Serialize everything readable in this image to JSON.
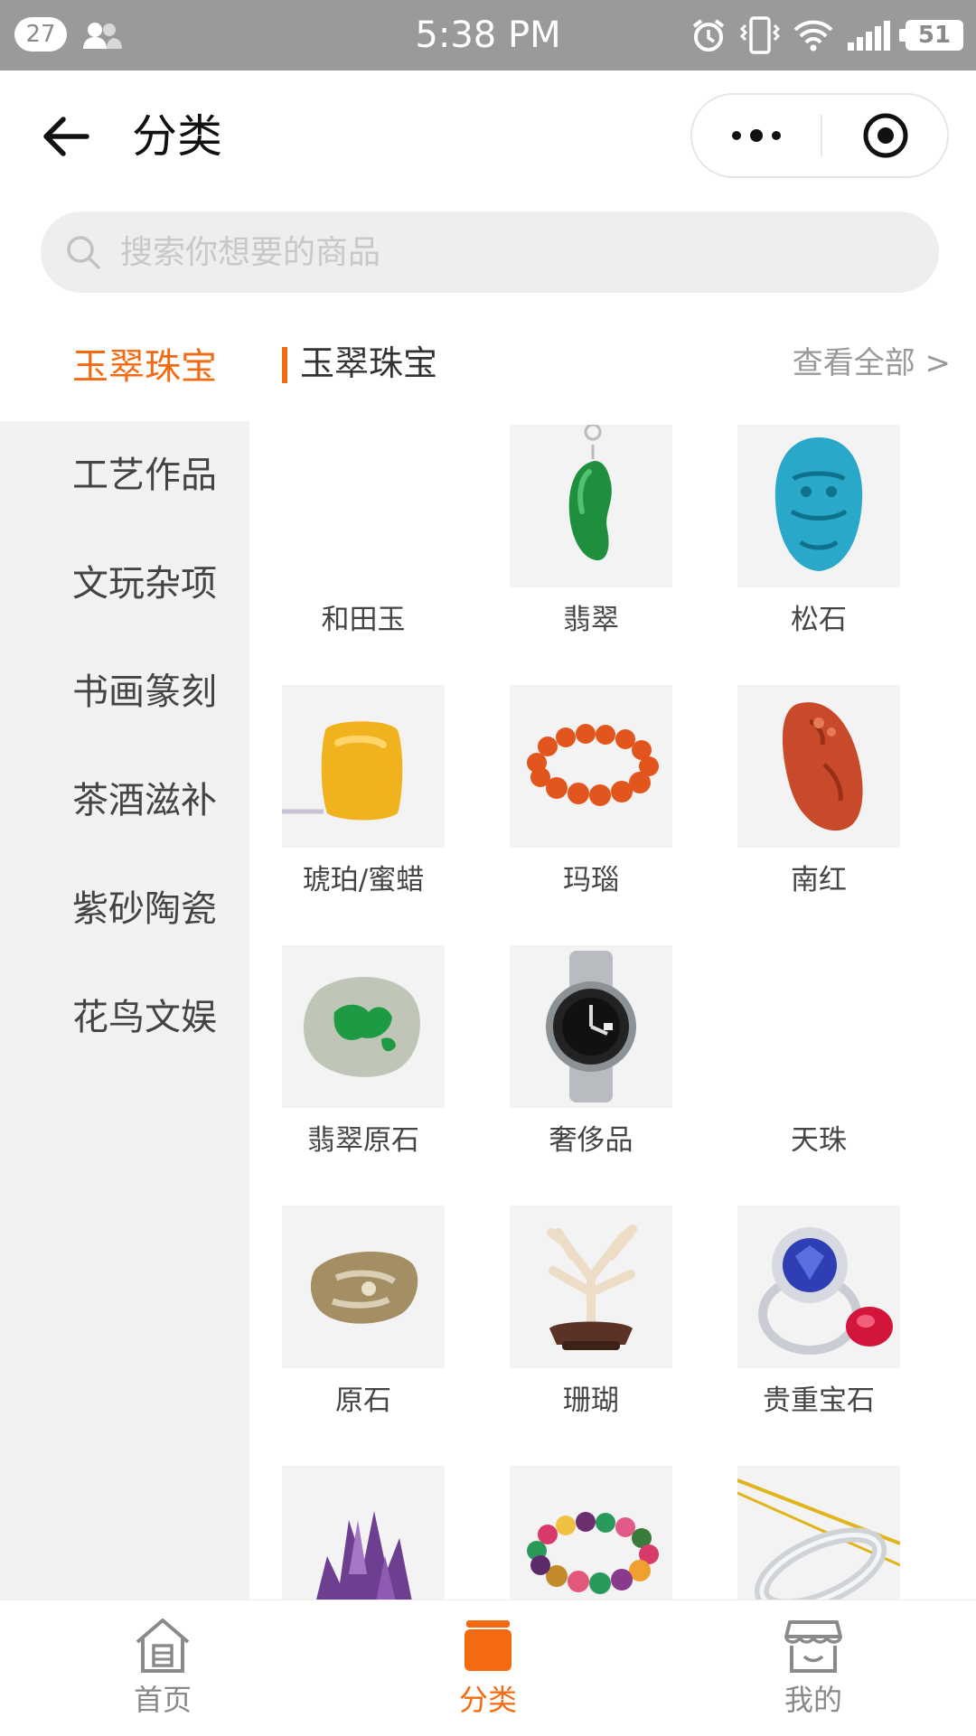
{
  "status_bar": {
    "badge": "27",
    "time": "5:38 PM",
    "battery": "51"
  },
  "nav": {
    "title": "分类"
  },
  "search": {
    "placeholder": "搜索你想要的商品"
  },
  "sidebar": {
    "items": [
      "玉翠珠宝",
      "工艺作品",
      "文玩杂项",
      "书画篆刻",
      "茶酒滋补",
      "紫砂陶瓷",
      "花鸟文娱"
    ],
    "active_index": 0
  },
  "section": {
    "title": "玉翠珠宝",
    "view_all": "查看全部 >"
  },
  "grid": {
    "items": [
      {
        "label": "和田玉",
        "icon": "empty"
      },
      {
        "label": "翡翠",
        "icon": "jade-pendant"
      },
      {
        "label": "松石",
        "icon": "turquoise-carving"
      },
      {
        "label": "琥珀/蜜蜡",
        "icon": "amber-block"
      },
      {
        "label": "玛瑙",
        "icon": "agate-bracelet"
      },
      {
        "label": "南红",
        "icon": "red-agate-carving"
      },
      {
        "label": "翡翠原石",
        "icon": "jade-raw-stone"
      },
      {
        "label": "奢侈品",
        "icon": "luxury-watch"
      },
      {
        "label": "天珠",
        "icon": "empty"
      },
      {
        "label": "原石",
        "icon": "raw-stone"
      },
      {
        "label": "珊瑚",
        "icon": "coral"
      },
      {
        "label": "贵重宝石",
        "icon": "gem-ring"
      },
      {
        "label": "",
        "icon": "amethyst"
      },
      {
        "label": "",
        "icon": "tourmaline-bracelet"
      },
      {
        "label": "",
        "icon": "silver-bangle"
      }
    ]
  },
  "tabbar": {
    "items": [
      {
        "label": "首页",
        "icon": "home-icon"
      },
      {
        "label": "分类",
        "icon": "category-icon"
      },
      {
        "label": "我的",
        "icon": "store-icon"
      }
    ],
    "active_index": 1
  },
  "colors": {
    "accent": "#f36a12",
    "status_bar": "#9a9a9a",
    "sidebar_bg": "#f2f2f2",
    "thumb_bg": "#f3f3f3"
  }
}
